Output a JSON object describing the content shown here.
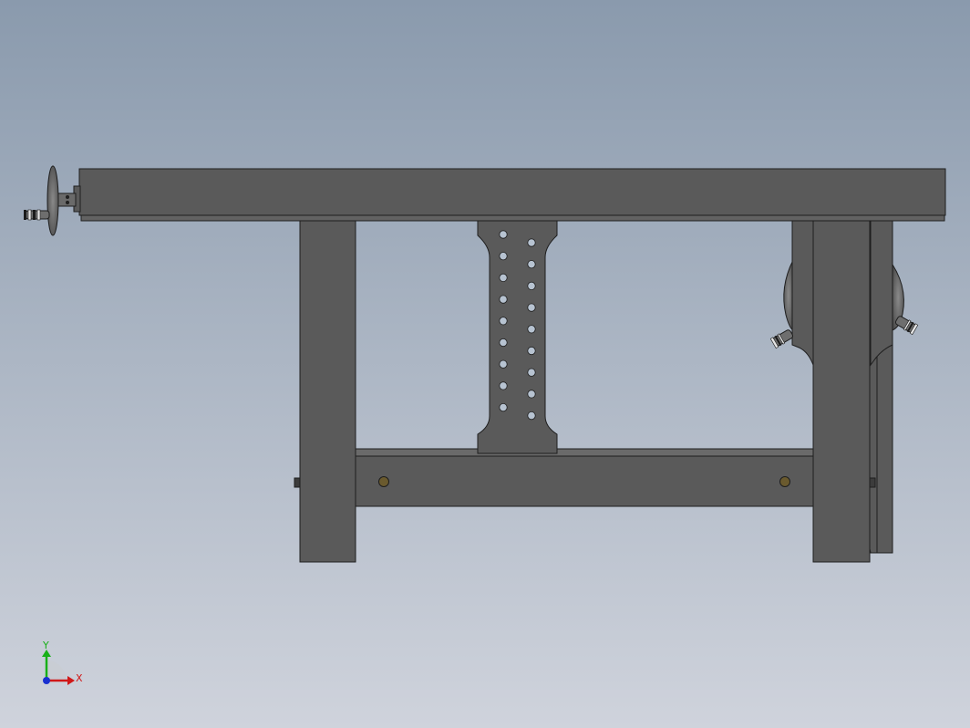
{
  "viewport": {
    "background_top": "#8a9aad",
    "background_bottom": "#cfd3dc",
    "model_color": "#5a5a5a",
    "edge_color": "#1e1e1e",
    "hole_color": "#b7c3d1",
    "bolt_color": "#6a5a2e"
  },
  "triad": {
    "x_label": "X",
    "y_label": "Y",
    "x_color": "#d01818",
    "y_color": "#18b018",
    "z_color": "#1830d0"
  }
}
